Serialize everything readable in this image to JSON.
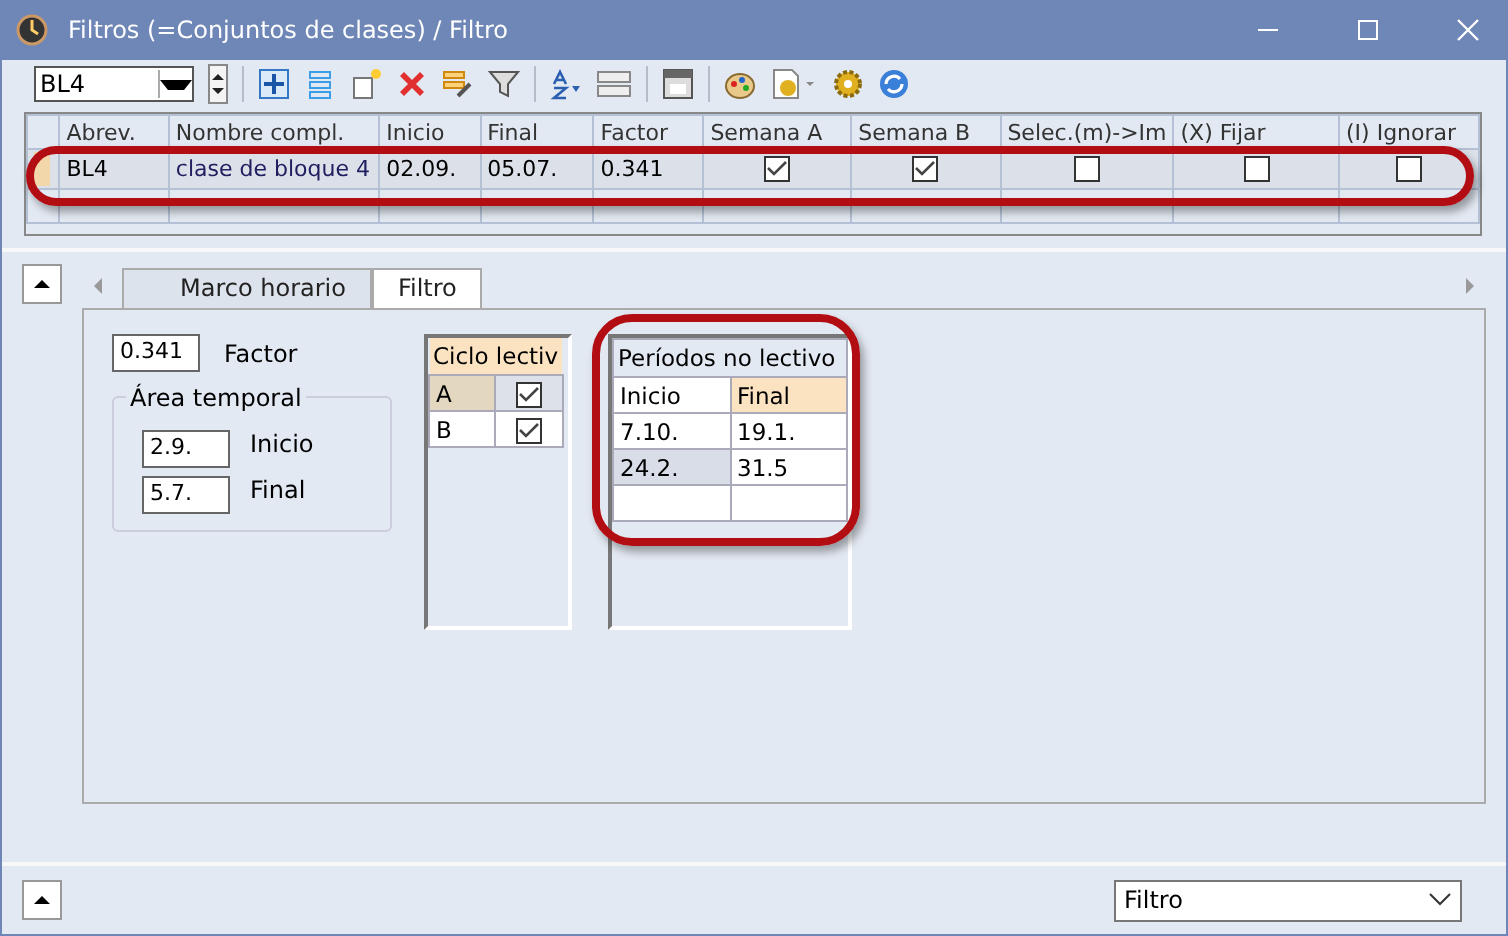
{
  "window": {
    "title": "Filtros (=Conjuntos de clases) / Filtro"
  },
  "toolbar": {
    "selector": "BL4"
  },
  "grid": {
    "columns": [
      "Abrev.",
      "Nombre compl.",
      "Inicio",
      "Final",
      "Factor",
      "Semana A",
      "Semana B",
      "Selec.(m)->Im",
      "(X) Fijar",
      "(I) Ignorar"
    ],
    "rows": [
      {
        "selected": true,
        "cells": [
          {
            "kind": "text",
            "text": "BL4"
          },
          {
            "kind": "text",
            "text": "clase de bloque 4"
          },
          {
            "kind": "text",
            "text": "02.09."
          },
          {
            "kind": "text",
            "text": "05.07."
          },
          {
            "kind": "text",
            "text": "0.341"
          },
          {
            "kind": "check",
            "checked": true
          },
          {
            "kind": "check",
            "checked": true
          },
          {
            "kind": "check",
            "checked": false
          },
          {
            "kind": "check",
            "checked": false
          },
          {
            "kind": "check",
            "checked": false
          }
        ]
      }
    ]
  },
  "tabs": [
    {
      "label": "Marco horario",
      "selected": false
    },
    {
      "label": "Filtro",
      "selected": true
    }
  ],
  "filter": {
    "factor": {
      "value": "0.341",
      "label": "Factor"
    },
    "area": {
      "title": "Área temporal",
      "fields": [
        {
          "value": "2.9.",
          "label": "Inicio"
        },
        {
          "value": "5.7.",
          "label": "Final"
        }
      ]
    },
    "cycle": {
      "title": "Ciclo lectiv",
      "rows": [
        {
          "label": "A",
          "checked": true,
          "selected": true
        },
        {
          "label": "B",
          "checked": true,
          "selected": false
        }
      ]
    },
    "periods": {
      "title": "Períodos no lectivo",
      "columns": [
        "Inicio",
        "Final"
      ],
      "rows": [
        [
          "7.10.",
          "19.1."
        ],
        [
          "24.2.",
          "31.5"
        ]
      ]
    }
  },
  "bottom": {
    "view_select": "Filtro"
  }
}
